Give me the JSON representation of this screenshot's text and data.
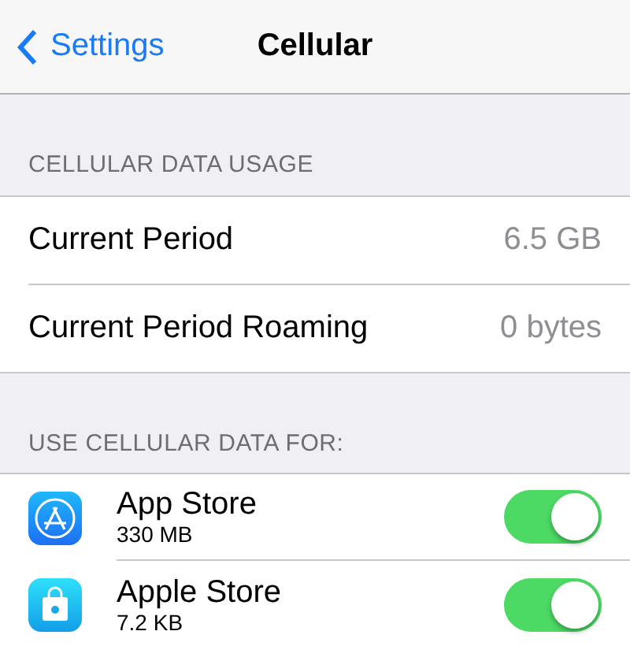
{
  "nav": {
    "back": "Settings",
    "title": "Cellular"
  },
  "usage": {
    "header": "CELLULAR DATA USAGE",
    "rows": [
      {
        "label": "Current Period",
        "value": "6.5 GB"
      },
      {
        "label": "Current Period Roaming",
        "value": "0 bytes"
      }
    ]
  },
  "apps": {
    "header": "USE CELLULAR DATA FOR:",
    "items": [
      {
        "kind": "appstore",
        "name": "App Store",
        "usage": "330 MB",
        "on": true
      },
      {
        "kind": "bag",
        "name": "Apple Store",
        "usage": "7.2 KB",
        "on": true
      }
    ]
  }
}
